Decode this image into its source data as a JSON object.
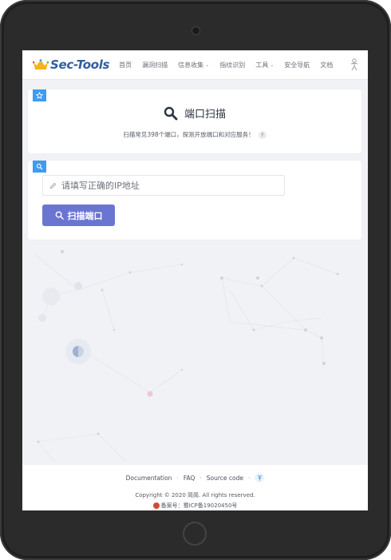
{
  "brand": {
    "name": "Sec-Tools"
  },
  "nav": {
    "items": [
      {
        "label": "首页",
        "dropdown": false
      },
      {
        "label": "漏洞扫描",
        "dropdown": false
      },
      {
        "label": "信息收集",
        "dropdown": true
      },
      {
        "label": "指纹识别",
        "dropdown": false
      },
      {
        "label": "工具",
        "dropdown": true
      },
      {
        "label": "安全导航",
        "dropdown": false
      },
      {
        "label": "文档",
        "dropdown": false
      }
    ]
  },
  "title_card": {
    "badge_icon": "star-icon",
    "heading_icon": "search-icon",
    "heading": "端口扫描",
    "subheading": "扫描常见398个端口，探测开放端口和对应服务！",
    "help": "?"
  },
  "form_card": {
    "badge_icon": "search-icon",
    "input": {
      "value": "",
      "placeholder": "请填写正确的IP地址"
    },
    "button_label": "扫描端口"
  },
  "footer": {
    "links": [
      "Documentation",
      "FAQ",
      "Source code"
    ],
    "copyright": "Copyright © 2020 简简. All rights reserved.",
    "beian": "备案号：蜀ICP备19020450号"
  },
  "colors": {
    "accent": "#6a75d2",
    "badge": "#3c9cf2",
    "brand": "#2f5f9e",
    "background": "#f1f2f5"
  }
}
